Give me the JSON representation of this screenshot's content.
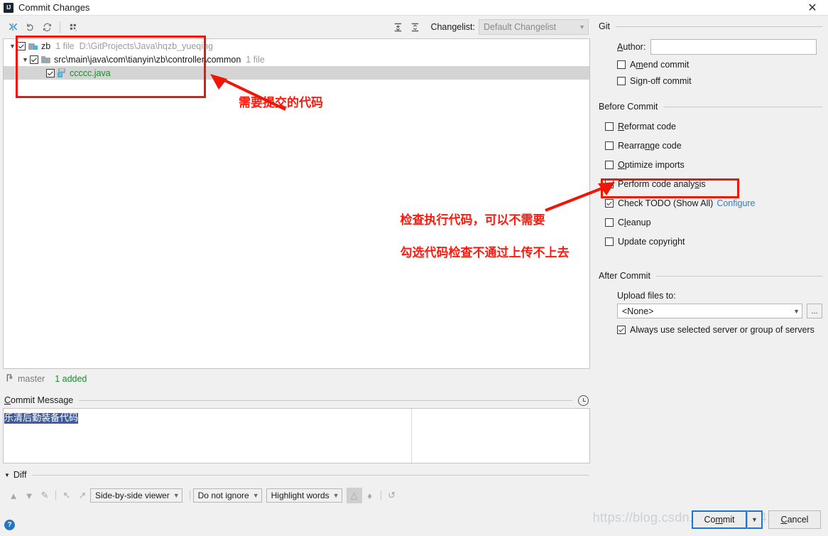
{
  "window": {
    "title": "Commit Changes",
    "logo_text": "IJ",
    "close_label": "✕"
  },
  "toolbar": {
    "icons": [
      "show-diff-icon",
      "rollback-icon",
      "refresh-icon",
      "group-by-icon"
    ],
    "expand_all_icon": "expand-all-icon",
    "collapse_all_icon": "collapse-all-icon",
    "changelist_label": "Changelist:",
    "changelist_value": "Default Changelist"
  },
  "tree": {
    "root": {
      "name": "zb",
      "meta": "1 file",
      "path": "D:\\GitProjects\\Java\\hqzb_yueqing",
      "checked": true,
      "expanded": true
    },
    "folder": {
      "name": "src\\main\\java\\com\\tianyin\\zb\\controller\\common",
      "meta": "1 file",
      "checked": true,
      "expanded": true
    },
    "file": {
      "name": "ccccc.java",
      "checked": true,
      "selected": true
    }
  },
  "annotations": {
    "commit_code": "需要提交的代码",
    "analysis_line1": "检查执行代码，可以不需要",
    "analysis_line2": "勾选代码检查不通过上传不上去",
    "box_color": "#f01505",
    "text_color": "#ff1a0d"
  },
  "status": {
    "branch_icon": "branch-icon",
    "branch": "master",
    "added": "1 added",
    "added_color": "#1a8c2e"
  },
  "commit_message": {
    "title": "Commit Message",
    "title_mnemonic": "C",
    "value": "乐清后勤装备代码",
    "history_icon": "clock-history-icon",
    "selection_color": "#3f5b9b"
  },
  "diff": {
    "title": "Diff",
    "expanded": true,
    "nav_icons": [
      "previous-difference-icon",
      "next-difference-icon",
      "jump-to-source-icon",
      "accept-left-icon",
      "accept-right-icon"
    ],
    "viewer_mode": "Side-by-side viewer",
    "ignore_mode": "Do not ignore",
    "highlight_mode": "Highlight words",
    "trailing_icons": [
      "highlight-toggle-icon",
      "collapse-unchanged-icon",
      "revert-icon"
    ],
    "help_icon": "help-icon",
    "help_label": "?"
  },
  "git_section": {
    "title": "Git",
    "author_label": "Author:",
    "author_mnemonic": "A",
    "author_value": "",
    "checkboxes": [
      {
        "label": "Amend commit",
        "mnemonic": "m",
        "checked": false,
        "name": "amend-commit"
      },
      {
        "label": "Sign-off commit",
        "mnemonic": "g",
        "checked": false,
        "name": "sign-off-commit"
      }
    ]
  },
  "before_commit": {
    "title": "Before Commit",
    "checkboxes": [
      {
        "label": "Reformat code",
        "mnemonic": "R",
        "checked": false,
        "name": "reformat-code"
      },
      {
        "label": "Rearrange code",
        "mnemonic": "n",
        "checked": false,
        "name": "rearrange-code"
      },
      {
        "label": "Optimize imports",
        "mnemonic": "O",
        "checked": false,
        "name": "optimize-imports"
      },
      {
        "label": "Perform code analysis",
        "mnemonic": "s",
        "checked": true,
        "name": "perform-code-analysis"
      },
      {
        "label": "Check TODO (Show All)",
        "mnemonic": "",
        "checked": true,
        "name": "check-todo",
        "link": "Configure"
      },
      {
        "label": "Cleanup",
        "mnemonic": "l",
        "checked": false,
        "name": "cleanup"
      },
      {
        "label": "Update copyright",
        "mnemonic": "",
        "checked": false,
        "name": "update-copyright"
      }
    ]
  },
  "after_commit": {
    "title": "After Commit",
    "upload_label": "Upload files to:",
    "upload_value": "<None>",
    "dots_label": "...",
    "always_use_label": "Always use selected server or group of servers",
    "always_use_checked": true
  },
  "buttons": {
    "commit": "Commit",
    "commit_mnemonic": "m",
    "commit_dropdown_icon": "chevron-down-icon",
    "cancel": "Cancel",
    "cancel_mnemonic": "C"
  },
  "watermark": "https://blog.csdn.net/weixin_41812784"
}
